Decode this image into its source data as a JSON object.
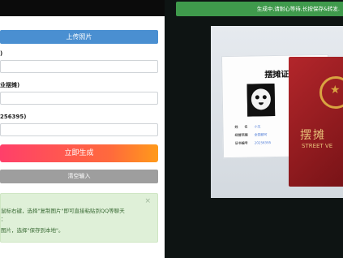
{
  "form": {
    "upload_label": "上传照片",
    "field1_label": ")",
    "field2_label": "业摆摊)",
    "field3_label": "256395)",
    "generate_label": "立即生成",
    "clear_label": "清空输入"
  },
  "tip": {
    "close": "×",
    "line1": "鼠标右键，选择\"复制图片\"即可直接粘贴到QQ等聊天",
    "line1b": "：",
    "line2": "图片，选择\"保存到本地\"。"
  },
  "status": {
    "text": "生成中,请耐心等待,长按保存&转发."
  },
  "preview": {
    "license_title": "摆摊证",
    "info": [
      {
        "label": "姓　　名",
        "value": "小王"
      },
      {
        "label": "经营范围",
        "value": "全国都可"
      },
      {
        "label": "证书编号",
        "value": "20256395"
      }
    ],
    "passport_title": "摆摊",
    "passport_sub": "STREET VE"
  }
}
